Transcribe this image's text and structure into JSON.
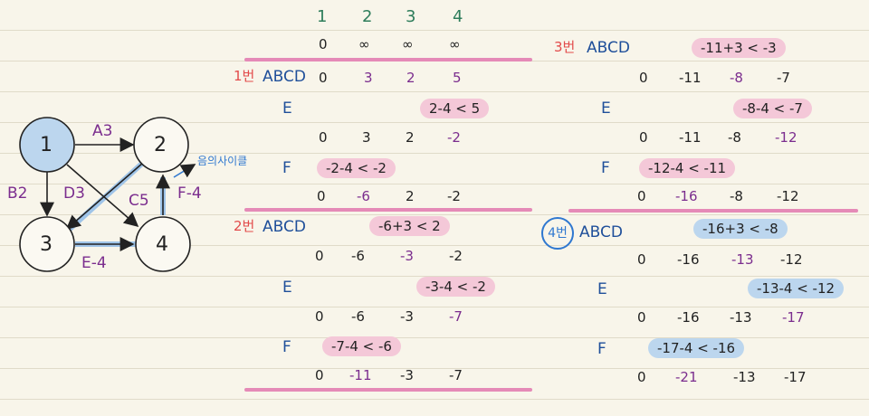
{
  "graph": {
    "nodes": [
      "1",
      "2",
      "3",
      "4"
    ],
    "edges": [
      {
        "label": "A3"
      },
      {
        "label": "B2"
      },
      {
        "label": "D3"
      },
      {
        "label": "C5"
      },
      {
        "label": "E-4"
      },
      {
        "label": "F-4"
      }
    ],
    "cycle_note": "음의사이클"
  },
  "colors": {
    "highlight_pink": "#f4c8d8",
    "highlight_blue": "#bcd6ee",
    "underline": "#e58ab7",
    "purple": "#7b2d8e",
    "blue": "#1f4f9a",
    "red": "#e24b4b",
    "green": "#2e7d5b"
  },
  "table": {
    "headers": [
      "1",
      "2",
      "3",
      "4"
    ],
    "init": [
      "0",
      "∞",
      "∞",
      "∞"
    ]
  },
  "round1": {
    "label": "1번",
    "abcd_label": "ABCD",
    "abcd_vals": [
      "0",
      "3",
      "2",
      "5"
    ],
    "e_label": "E",
    "e_note": "2-4 < 5",
    "e_vals": [
      "0",
      "3",
      "2",
      "-2"
    ],
    "f_label": "F",
    "f_note": "-2-4 < -2",
    "f_vals": [
      "0",
      "-6",
      "2",
      "-2"
    ]
  },
  "round2": {
    "label": "2번",
    "abcd_label": "ABCD",
    "abcd_note": "-6+3 < 2",
    "abcd_vals": [
      "0",
      "-6",
      "-3",
      "-2"
    ],
    "e_label": "E",
    "e_note": "-3-4 < -2",
    "e_vals": [
      "0",
      "-6",
      "-3",
      "-7"
    ],
    "f_label": "F",
    "f_note": "-7-4 < -6",
    "f_vals": [
      "0",
      "-11",
      "-3",
      "-7"
    ]
  },
  "round3": {
    "label": "3번",
    "abcd_label": "ABCD",
    "abcd_note": "-11+3 < -3",
    "abcd_vals": [
      "0",
      "-11",
      "-8",
      "-7"
    ],
    "e_label": "E",
    "e_note": "-8-4 < -7",
    "e_vals": [
      "0",
      "-11",
      "-8",
      "-12"
    ],
    "f_label": "F",
    "f_note": "-12-4 < -11",
    "f_vals": [
      "0",
      "-16",
      "-8",
      "-12"
    ]
  },
  "round4": {
    "label": "4번",
    "abcd_label": "ABCD",
    "abcd_note": "-16+3 < -8",
    "abcd_vals": [
      "0",
      "-16",
      "-13",
      "-12"
    ],
    "e_label": "E",
    "e_note": "-13-4 < -12",
    "e_vals": [
      "0",
      "-16",
      "-13",
      "-17"
    ],
    "f_label": "F",
    "f_note": "-17-4 < -16",
    "f_vals": [
      "0",
      "-21",
      "-13",
      "-17"
    ]
  }
}
